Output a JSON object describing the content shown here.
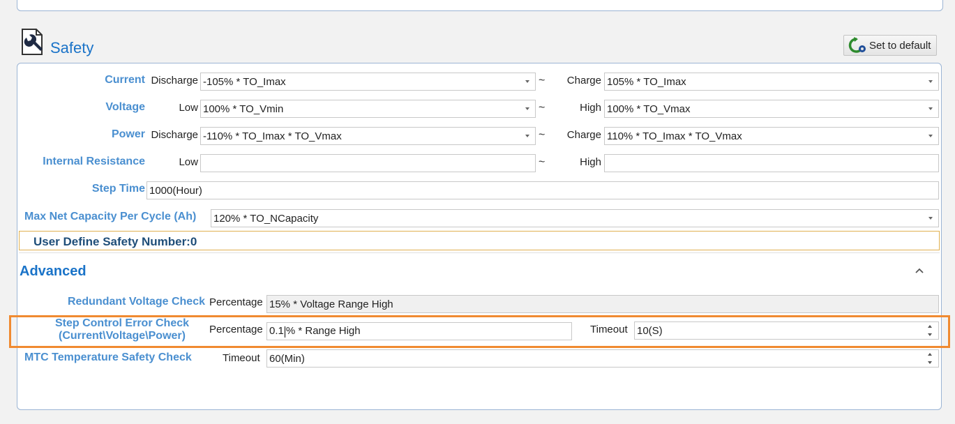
{
  "header": {
    "title": "Safety",
    "default_button": "Set to default",
    "icon": "wrench-document-icon",
    "default_icon": "refresh-gear-icon"
  },
  "rows": {
    "current": {
      "label": "Current",
      "left_label": "Discharge",
      "left_value": "-105% * TO_Imax",
      "tilde": "~",
      "right_label": "Charge",
      "right_value": "105% * TO_Imax"
    },
    "voltage": {
      "label": "Voltage",
      "left_label": "Low",
      "left_value": "100% * TO_Vmin",
      "tilde": "~",
      "right_label": "High",
      "right_value": "100% * TO_Vmax"
    },
    "power": {
      "label": "Power",
      "left_label": "Discharge",
      "left_value": "-110% * TO_Imax * TO_Vmax",
      "tilde": "~",
      "right_label": "Charge",
      "right_value": "110% * TO_Imax * TO_Vmax"
    },
    "resistance": {
      "label": "Internal Resistance",
      "left_label": "Low",
      "left_value": "",
      "tilde": "~",
      "right_label": "High",
      "right_value": ""
    },
    "step_time": {
      "label": "Step Time",
      "value": "1000(Hour)"
    },
    "max_net": {
      "label": "Max Net Capacity Per Cycle (Ah)",
      "value": "120% * TO_NCapacity"
    }
  },
  "user_define": "User Define Safety Number:0",
  "advanced": {
    "title": "Advanced",
    "redundant": {
      "label": "Redundant Voltage Check",
      "sub_label": "Percentage",
      "value": "15% * Voltage Range High"
    },
    "step_control": {
      "label_line1": "Step Control Error Check",
      "label_line2": "(Current\\Voltage\\Power)",
      "sub_label": "Percentage",
      "value_before_caret": "0.1",
      "value_after_caret": "% * Range High",
      "timeout_label": "Timeout",
      "timeout_value": "10(S)"
    },
    "mtc": {
      "label": "MTC Temperature Safety Check",
      "timeout_label": "Timeout",
      "timeout_value": "60(Min)"
    }
  },
  "colors": {
    "accent": "#1a73c8",
    "label_blue": "#4a8fd0",
    "highlight": "#f08a30",
    "panel_border": "#9bb4d4"
  }
}
